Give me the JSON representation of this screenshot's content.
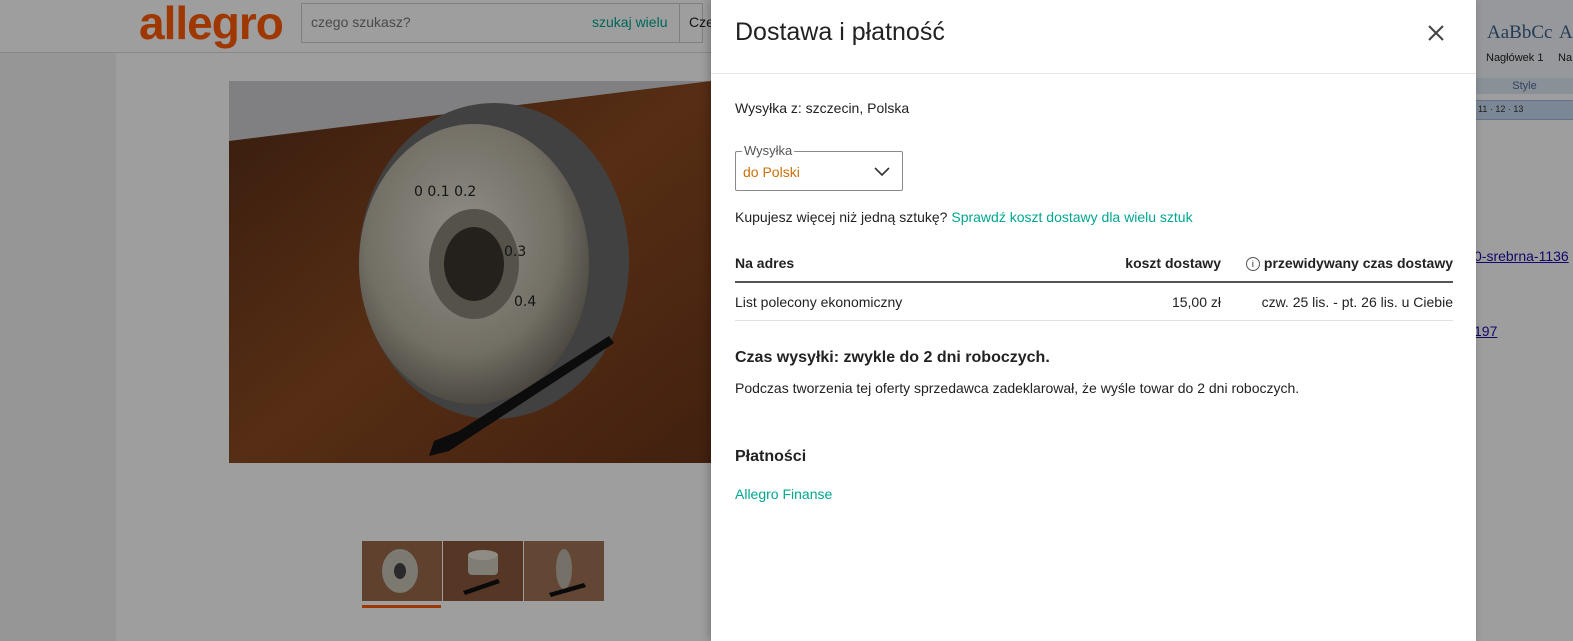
{
  "background_page": {
    "logo": "allegro",
    "search_placeholder": "czego szukasz?",
    "search_multi_label": "szukaj wielu",
    "category_label_partial": "Cze",
    "thumbnail_count": 3
  },
  "side_window": {
    "style_preview_1": "AaBbCc",
    "style_preview_2": "A",
    "style_caption_1": "Nagłówek 1",
    "style_caption_2": "Na",
    "style_group_label": "Style",
    "ruler_text": "11 · 12 · 13",
    "link_1": "0-srebrna-1136",
    "link_2": "197"
  },
  "modal": {
    "title": "Dostawa i płatność",
    "ship_from": "Wysyłka z: szczecin, Polska",
    "shipping_select": {
      "legend": "Wysyłka",
      "value": "do Polski"
    },
    "multi_question": "Kupujesz więcej niż jedną sztukę?",
    "multi_link": "Sprawdź koszt dostawy dla wielu sztuk",
    "table": {
      "col_address": "Na adres",
      "col_cost": "koszt dostawy",
      "col_time": "przewidywany czas dostawy",
      "info_symbol": "i",
      "rows": [
        {
          "method": "List polecony ekonomiczny",
          "cost": "15,00 zł",
          "time": "czw. 25 lis. - pt. 26 lis. u Ciebie"
        }
      ]
    },
    "dispatch_heading": "Czas wysyłki: zwykle do 2 dni roboczych.",
    "dispatch_text": "Podczas tworzenia tej oferty sprzedawca zadeklarował, że wyśle towar do 2 dni roboczych.",
    "payments_heading": "Płatności",
    "payments_link": "Allegro Finanse"
  }
}
